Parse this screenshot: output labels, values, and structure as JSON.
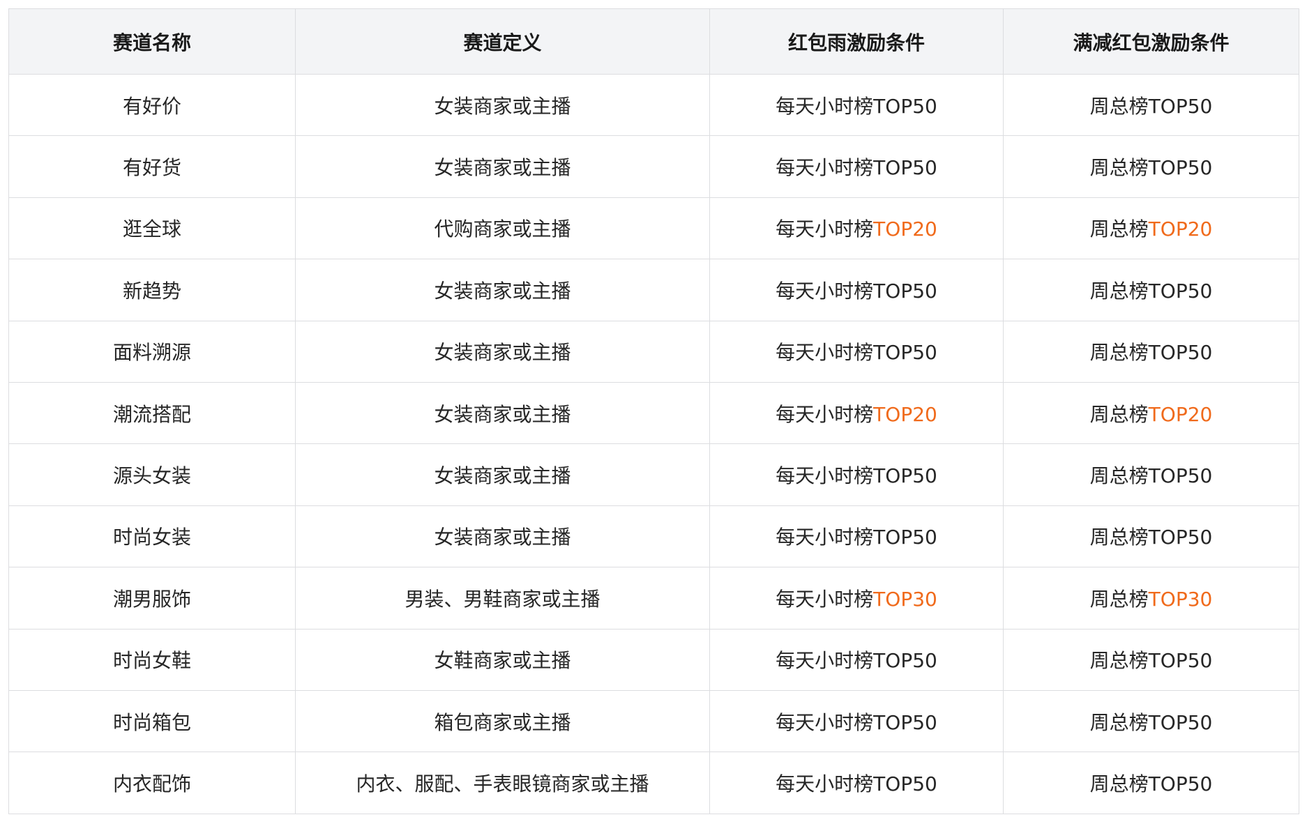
{
  "table": {
    "headers": [
      "赛道名称",
      "赛道定义",
      "红包雨激励条件",
      "满减红包激励条件"
    ],
    "highlight_color": "#f06a1b",
    "rows": [
      {
        "name": "有好价",
        "definition": "女装商家或主播",
        "rain_prefix": "每天小时榜",
        "rain_rank": "TOP50",
        "discount_prefix": "周总榜",
        "discount_rank": "TOP50",
        "highlight": false
      },
      {
        "name": "有好货",
        "definition": "女装商家或主播",
        "rain_prefix": "每天小时榜",
        "rain_rank": "TOP50",
        "discount_prefix": "周总榜",
        "discount_rank": "TOP50",
        "highlight": false
      },
      {
        "name": "逛全球",
        "definition": "代购商家或主播",
        "rain_prefix": "每天小时榜",
        "rain_rank": "TOP20",
        "discount_prefix": "周总榜",
        "discount_rank": "TOP20",
        "highlight": true
      },
      {
        "name": "新趋势",
        "definition": "女装商家或主播",
        "rain_prefix": "每天小时榜",
        "rain_rank": "TOP50",
        "discount_prefix": "周总榜",
        "discount_rank": "TOP50",
        "highlight": false
      },
      {
        "name": "面料溯源",
        "definition": "女装商家或主播",
        "rain_prefix": "每天小时榜",
        "rain_rank": "TOP50",
        "discount_prefix": "周总榜",
        "discount_rank": "TOP50",
        "highlight": false
      },
      {
        "name": "潮流搭配",
        "definition": "女装商家或主播",
        "rain_prefix": "每天小时榜",
        "rain_rank": "TOP20",
        "discount_prefix": "周总榜",
        "discount_rank": "TOP20",
        "highlight": true
      },
      {
        "name": "源头女装",
        "definition": "女装商家或主播",
        "rain_prefix": "每天小时榜",
        "rain_rank": "TOP50",
        "discount_prefix": "周总榜",
        "discount_rank": "TOP50",
        "highlight": false
      },
      {
        "name": "时尚女装",
        "definition": "女装商家或主播",
        "rain_prefix": "每天小时榜",
        "rain_rank": "TOP50",
        "discount_prefix": "周总榜",
        "discount_rank": "TOP50",
        "highlight": false
      },
      {
        "name": "潮男服饰",
        "definition": "男装、男鞋商家或主播",
        "rain_prefix": "每天小时榜",
        "rain_rank": "TOP30",
        "discount_prefix": "周总榜",
        "discount_rank": "TOP30",
        "highlight": true
      },
      {
        "name": "时尚女鞋",
        "definition": "女鞋商家或主播",
        "rain_prefix": "每天小时榜",
        "rain_rank": "TOP50",
        "discount_prefix": "周总榜",
        "discount_rank": "TOP50",
        "highlight": false
      },
      {
        "name": "时尚箱包",
        "definition": "箱包商家或主播",
        "rain_prefix": "每天小时榜",
        "rain_rank": "TOP50",
        "discount_prefix": "周总榜",
        "discount_rank": "TOP50",
        "highlight": false
      },
      {
        "name": "内衣配饰",
        "definition": "内衣、服配、手表眼镜商家或主播",
        "rain_prefix": "每天小时榜",
        "rain_rank": "TOP50",
        "discount_prefix": "周总榜",
        "discount_rank": "TOP50",
        "highlight": false
      }
    ]
  }
}
